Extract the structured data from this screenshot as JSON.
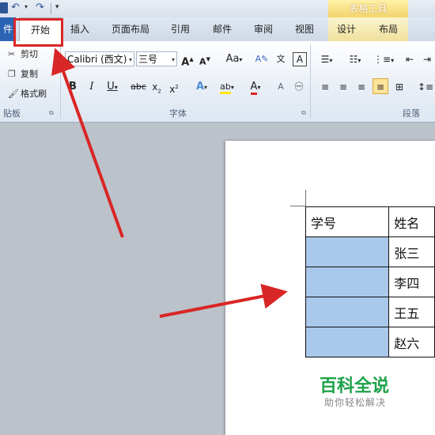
{
  "titlebar": {
    "context_tool_header": "表格工具"
  },
  "tabs": {
    "file": "件",
    "items": [
      {
        "key": "home",
        "label": "开始"
      },
      {
        "key": "insert",
        "label": "插入"
      },
      {
        "key": "layout",
        "label": "页面布局"
      },
      {
        "key": "references",
        "label": "引用"
      },
      {
        "key": "mailings",
        "label": "邮件"
      },
      {
        "key": "review",
        "label": "审阅"
      },
      {
        "key": "view",
        "label": "视图"
      },
      {
        "key": "design",
        "label": "设计"
      },
      {
        "key": "table_layout",
        "label": "布局"
      }
    ]
  },
  "ribbon": {
    "clipboard": {
      "label": "贴板",
      "cut": "剪切",
      "copy": "复制",
      "format_painter": "格式刷"
    },
    "font": {
      "label": "字体",
      "font_name": "Calibri (西文)",
      "font_size": "三号"
    },
    "paragraph": {
      "label": "段落"
    }
  },
  "document": {
    "table": {
      "header": [
        "学号",
        "姓名"
      ],
      "rows": [
        [
          "",
          "张三"
        ],
        [
          "",
          "李四"
        ],
        [
          "",
          "王五"
        ],
        [
          "",
          "赵六"
        ]
      ]
    }
  },
  "watermark": {
    "title": "百科全说",
    "subtitle": "助你轻松解决"
  },
  "colors": {
    "highlight": "#d92626",
    "selection": "#a9c8ea",
    "watermark": "#1ea24a"
  }
}
